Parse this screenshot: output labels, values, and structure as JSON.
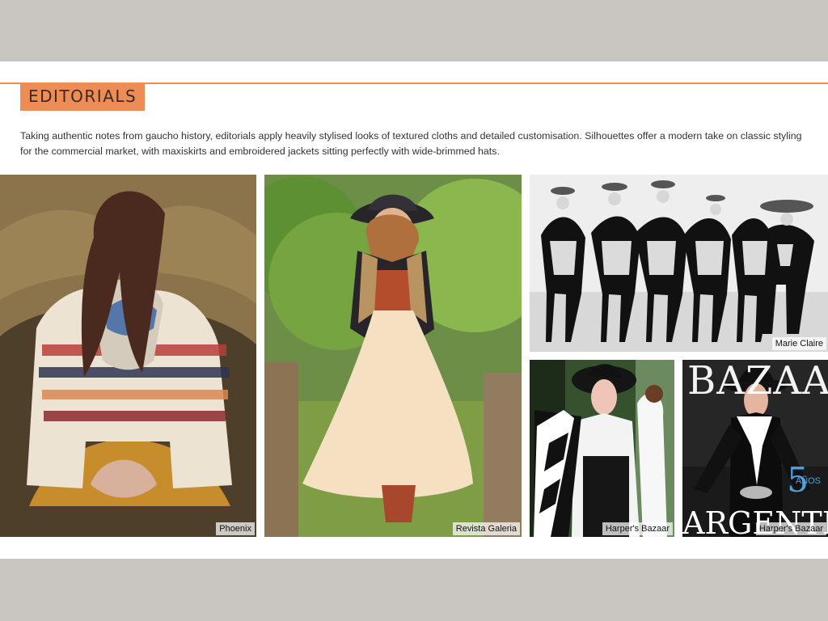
{
  "section": {
    "title": "EDITORIALS",
    "intro": "Taking authentic notes from gaucho history, editorials apply heavily stylised looks of textured cloths and detailed customisation. Silhouettes offer a modern take on classic styling for the commercial market, with maxiskirts and embroidered jackets sitting perfectly with wide-brimmed hats."
  },
  "images": [
    {
      "caption": "Phoenix",
      "subject": "woman in fringed striped poncho and scarf seated by hay"
    },
    {
      "caption": "Revista Galeria",
      "subject": "woman in wide-brimmed hat and long cream skirt standing between fence posts"
    },
    {
      "caption": "Marie Claire",
      "subject": "gauchos on horseback in black and white"
    },
    {
      "caption": "Harper's Bazaar",
      "subject": "woman in black hat and white blouse with patterned blanket"
    },
    {
      "caption": "Harper's Bazaar",
      "subject": "Harper's Bazaar Argentina cover with woman in black hat and white bow"
    }
  ],
  "cover": {
    "masthead": "BAZAAR",
    "edition": "ARGENTINA",
    "anniversary_number": "5",
    "anniversary_label": "AÑOS"
  },
  "colors": {
    "background": "#c9c5c1",
    "accent": "#ee8c56",
    "text": "#333333"
  }
}
